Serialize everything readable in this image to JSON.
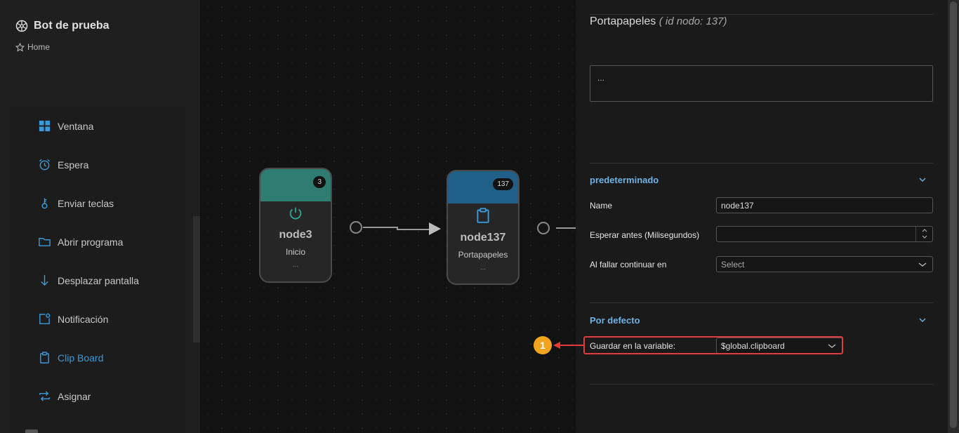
{
  "app": {
    "title": "Bot de prueba",
    "breadcrumb": "Home"
  },
  "sidebar": {
    "items": [
      {
        "label": "Ventana",
        "icon": "grid-icon"
      },
      {
        "label": "Espera",
        "icon": "alarm-clock-icon"
      },
      {
        "label": "Enviar teclas",
        "icon": "key-icon"
      },
      {
        "label": "Abrir programa",
        "icon": "folder-icon"
      },
      {
        "label": "Desplazar pantalla",
        "icon": "arrow-down-icon"
      },
      {
        "label": "Notificación",
        "icon": "notification-icon"
      },
      {
        "label": "Clip Board",
        "icon": "clipboard-icon",
        "active": true
      },
      {
        "label": "Asignar",
        "icon": "assign-arrows-icon"
      }
    ]
  },
  "canvas": {
    "nodes": [
      {
        "id_badge": "3",
        "name": "node3",
        "type": "Inicio",
        "more": "...",
        "color": "#2f7d70",
        "icon": "power-icon"
      },
      {
        "id_badge": "137",
        "name": "node137",
        "type": "Portapapeles",
        "more": "...",
        "color": "#1f5f88",
        "icon": "clipboard-icon"
      }
    ]
  },
  "panel": {
    "title": "Portapapeles",
    "subtitle": "( id nodo: 137)",
    "description": "...",
    "section_default": {
      "title": "predeterminado",
      "name_label": "Name",
      "name_value": "node137",
      "wait_label": "Esperar antes (Milisegundos)",
      "wait_value": "",
      "onfail_label": "Al fallar continuar en",
      "onfail_value": "Select"
    },
    "section_bydefault": {
      "title": "Por defecto",
      "var_label": "Guardar en la variable:",
      "var_value": "$global.clipboard"
    }
  },
  "callout": {
    "number": "1",
    "color": "#f0a31f",
    "highlight_color": "#e23b3b"
  },
  "colors": {
    "accent": "#3a9ad9",
    "section": "#6fb3e6"
  }
}
